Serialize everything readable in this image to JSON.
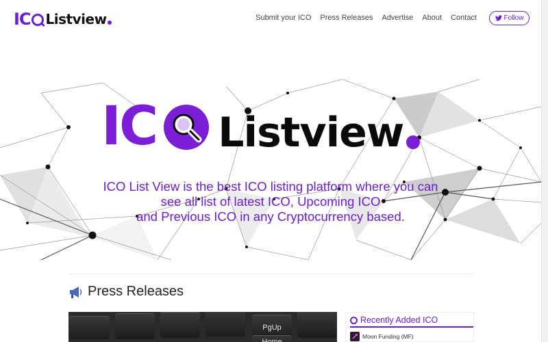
{
  "navbar": {
    "logo": {
      "ico": "IC",
      "name": "Listview"
    },
    "links": [
      "Submit your ICO",
      "Press Releases",
      "Advertise",
      "About",
      "Contact"
    ],
    "follow_label": "Follow"
  },
  "hero": {
    "brand_ico": "IC",
    "brand_name": "Listview",
    "tagline_lines": [
      "ICO List View is the best ICO listing platform where you can",
      "see all list of latest ICO, Upcoming ICO",
      "and Previous ICO in any Cryptocurrency based."
    ]
  },
  "press": {
    "title": "Press Releases",
    "keyboard_keys": [
      "PgUp",
      "Home"
    ]
  },
  "sidebar": {
    "heading": "Recently Added ICO",
    "items": [
      "Moon Funding (MF)"
    ]
  },
  "colors": {
    "accent": "#6a1fd1",
    "brand_dark": "#0a0a0a"
  },
  "icons": [
    "twitter-icon",
    "search-icon",
    "megaphone-icon",
    "ring-icon",
    "rocket-icon"
  ]
}
